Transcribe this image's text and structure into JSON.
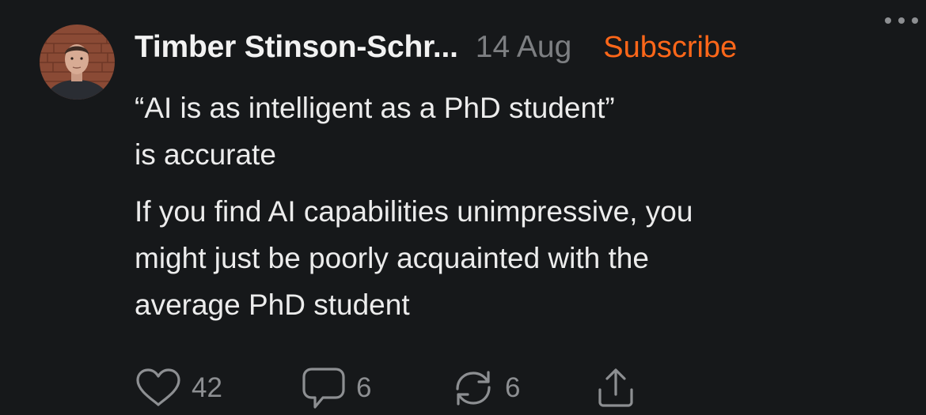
{
  "post": {
    "author": "Timber Stinson-Schr...",
    "date": "14 Aug",
    "subscribe_label": "Subscribe",
    "paragraphs": [
      "“AI is as intelligent as a PhD student”\nis accurate",
      "If you find AI capabilities unimpressive, you\nmight just be poorly acquainted with the\naverage PhD student"
    ]
  },
  "actions": {
    "likes": "42",
    "comments": "6",
    "restacks": "6"
  },
  "icons": {
    "avatar": "profile-photo",
    "more": "ellipsis-icon",
    "like": "heart-icon",
    "comment": "speech-bubble-icon",
    "restack": "restack-arrows-icon",
    "share": "share-icon"
  },
  "colors": {
    "background": "#16181a",
    "accent": "#ff6719",
    "text": "#ececec",
    "muted": "#7d7f82"
  }
}
